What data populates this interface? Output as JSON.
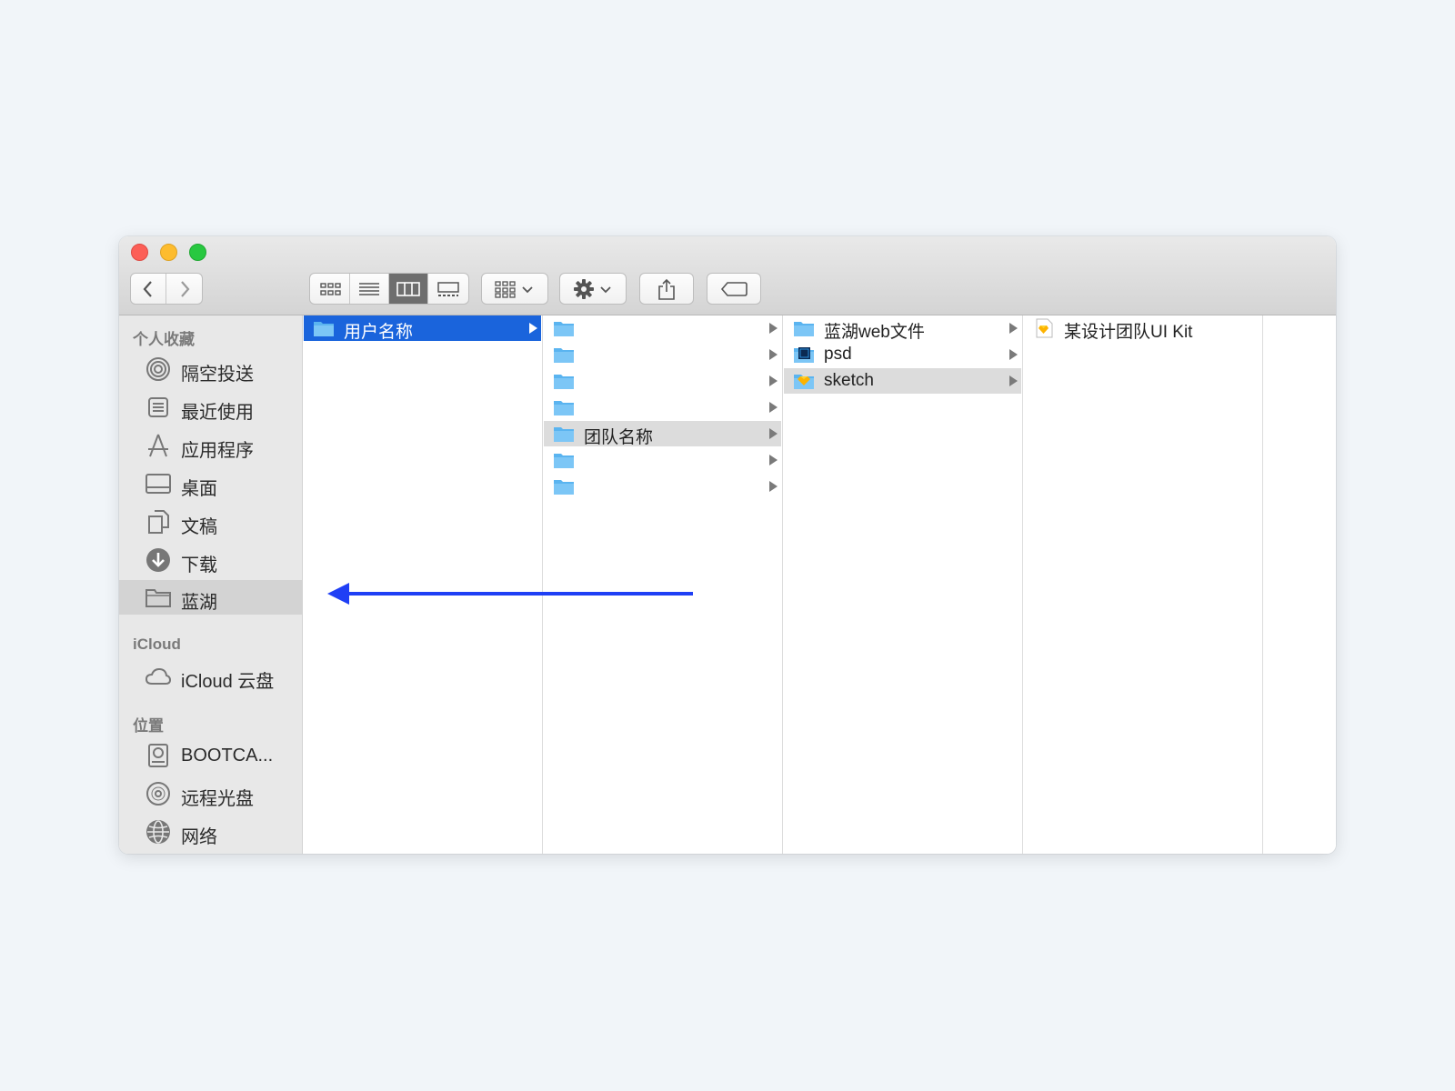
{
  "toolbar": {
    "back": "back",
    "forward": "forward",
    "view_modes": [
      "icon-view",
      "list-view",
      "column-view",
      "gallery-view"
    ],
    "active_view": "column-view"
  },
  "sidebar": {
    "favorites_title": "个人收藏",
    "favorites": [
      {
        "label": "隔空投送",
        "icon": "airdrop-icon"
      },
      {
        "label": "最近使用",
        "icon": "recents-icon"
      },
      {
        "label": "应用程序",
        "icon": "applications-icon"
      },
      {
        "label": "桌面",
        "icon": "desktop-icon"
      },
      {
        "label": "文稿",
        "icon": "documents-icon"
      },
      {
        "label": "下载",
        "icon": "downloads-icon"
      },
      {
        "label": "蓝湖",
        "icon": "folder-icon",
        "selected": true
      }
    ],
    "icloud_title": "iCloud",
    "icloud": [
      {
        "label": "iCloud 云盘",
        "icon": "cloud-icon"
      }
    ],
    "locations_title": "位置",
    "locations": [
      {
        "label": "BOOTCA...",
        "icon": "disk-icon"
      },
      {
        "label": "远程光盘",
        "icon": "optical-disc-icon"
      },
      {
        "label": "网络",
        "icon": "network-icon"
      }
    ]
  },
  "columns": {
    "col1": [
      {
        "name": "用户名称"
      }
    ],
    "col2": [
      {
        "name": ""
      },
      {
        "name": ""
      },
      {
        "name": ""
      },
      {
        "name": ""
      },
      {
        "name": "团队名称"
      },
      {
        "name": ""
      },
      {
        "name": ""
      }
    ],
    "col3": [
      {
        "name": "蓝湖web文件"
      },
      {
        "name": "psd"
      },
      {
        "name": "sketch"
      }
    ],
    "col4": [
      {
        "name": "某设计团队UI Kit"
      }
    ]
  },
  "colors": {
    "selection_blue": "#1a64dc",
    "annotation_arrow": "#1f3ff5",
    "folder_blue": "#5ab4f0"
  }
}
